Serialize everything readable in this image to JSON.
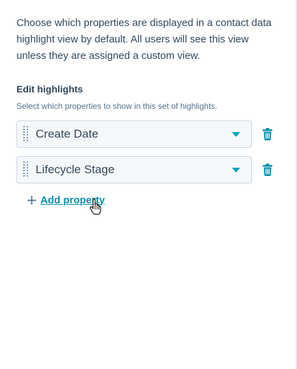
{
  "description": "Choose which properties are displayed in a contact data highlight view by default. All users will see this view unless they are assigned a custom view.",
  "highlights": {
    "title": "Edit highlights",
    "subtitle": "Select which properties to show in this set of highlights.",
    "properties": [
      {
        "label": "Create Date"
      },
      {
        "label": "Lifecycle Stage"
      }
    ],
    "add_label": "Add property"
  },
  "icons": {
    "drag": "drag-handle-icon",
    "dropdown": "chevron-down-icon",
    "delete": "trash-icon",
    "add": "plus-icon",
    "cursor": "hand-pointer-icon"
  },
  "colors": {
    "text": "#33475b",
    "accent": "#00a4bd",
    "link": "#0091ae",
    "field_bg": "#f5f8fa",
    "field_border": "#cbd6e2"
  }
}
